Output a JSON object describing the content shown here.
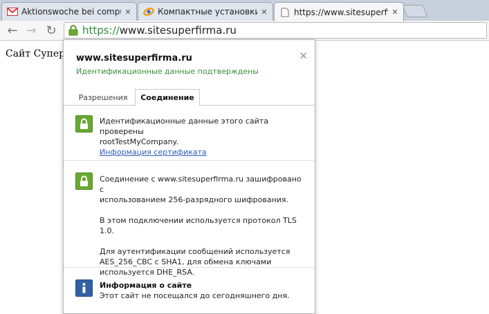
{
  "tabs": [
    {
      "title": "Aktionswoche bei computer",
      "favicon": "gmail-icon",
      "active": false
    },
    {
      "title": "Компактные установки fr",
      "favicon": "orange-swirl-icon",
      "active": false
    },
    {
      "title": "https://www.sitesuperfirma",
      "favicon": "page-icon",
      "active": true
    }
  ],
  "toolbar": {
    "back": "←",
    "forward": "→",
    "reload": "↻",
    "url_scheme": "https://",
    "url_host": "www.sitesuperfirma.ru"
  },
  "page": {
    "text": "Сайт Супер"
  },
  "popup": {
    "host": "www.sitesuperfirma.ru",
    "verified": "Идентификационные данные подтверждены",
    "tabs": [
      "Разрешения",
      "Соединение"
    ],
    "selected_tab": "Соединение",
    "identity": {
      "line1": "Идентификационные данные этого сайта проверены",
      "line2": "rootTestMyCompany.",
      "cert_link": "Информация сертификата"
    },
    "connection": {
      "p1a": "Соединение с www.sitesuperfirma.ru зашифровано с",
      "p1b": "использованием 256-разрядного шифрования.",
      "p2": "В этом подключении используется протокол TLS 1.0.",
      "p3a": "Для аутентификации сообщений используется",
      "p3b": "AES_256_CBC с SHA1, для обмена ключами",
      "p3c": "используется DHE_RSA."
    },
    "siteinfo": {
      "title": "Информация о сайте",
      "text": "Этот сайт не посещался до сегодняшнего дня."
    }
  },
  "colors": {
    "secure_green": "#2d8a36",
    "lock_green": "#6aa832",
    "info_blue": "#3261a3",
    "link_blue": "#2b5db8"
  }
}
